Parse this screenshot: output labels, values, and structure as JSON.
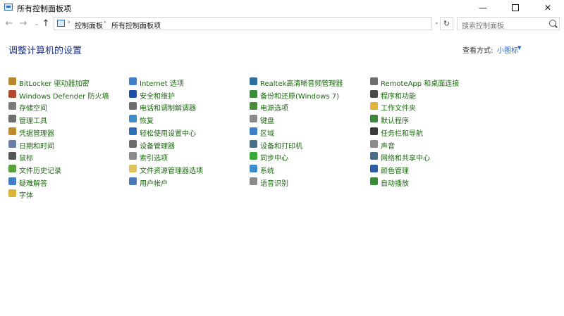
{
  "window": {
    "title": "所有控制面板项"
  },
  "window_controls": {
    "minimize": "—",
    "maximize": "",
    "close": "✕"
  },
  "nav": {
    "back": "←",
    "forward": "→",
    "recent": "⌄",
    "up": "↑",
    "breadcrumb": [
      "控制面板",
      "所有控制面板项"
    ],
    "separator": "›",
    "dropdown": "⌄",
    "refresh": "↻",
    "search_placeholder": "搜索控制面板"
  },
  "header": {
    "title": "调整计算机的设置",
    "view_by_label": "查看方式:",
    "view_by_value": "小图标",
    "view_by_caret": "▼"
  },
  "columns": [
    {
      "items": [
        {
          "label": "BitLocker 驱动器加密",
          "icon": "bitlocker-icon",
          "color": "#b8862e"
        },
        {
          "label": "Windows Defender 防火墙",
          "icon": "firewall-icon",
          "color": "#b04a2e"
        },
        {
          "label": "存储空间",
          "icon": "storage-spaces-icon",
          "color": "#7a7a7a"
        },
        {
          "label": "管理工具",
          "icon": "admin-tools-icon",
          "color": "#6d6d6d"
        },
        {
          "label": "凭据管理器",
          "icon": "credential-manager-icon",
          "color": "#c08a2a"
        },
        {
          "label": "日期和时间",
          "icon": "date-time-icon",
          "color": "#6a7fa8"
        },
        {
          "label": "鼠标",
          "icon": "mouse-icon",
          "color": "#555555"
        },
        {
          "label": "文件历史记录",
          "icon": "file-history-icon",
          "color": "#5ba03a"
        },
        {
          "label": "疑难解答",
          "icon": "troubleshooting-icon",
          "color": "#3f7cc2"
        },
        {
          "label": "字体",
          "icon": "fonts-icon",
          "color": "#d8b43a"
        }
      ]
    },
    {
      "items": [
        {
          "label": "Internet 选项",
          "icon": "internet-options-icon",
          "color": "#3d7fc8"
        },
        {
          "label": "安全和维护",
          "icon": "security-maintenance-icon",
          "color": "#1e4fa8"
        },
        {
          "label": "电话和调制解调器",
          "icon": "phone-modem-icon",
          "color": "#6d6d6d"
        },
        {
          "label": "恢复",
          "icon": "recovery-icon",
          "color": "#3d8ec8"
        },
        {
          "label": "轻松使用设置中心",
          "icon": "ease-of-access-icon",
          "color": "#2a6fb8"
        },
        {
          "label": "设备管理器",
          "icon": "device-manager-icon",
          "color": "#6d6d6d"
        },
        {
          "label": "索引选项",
          "icon": "indexing-options-icon",
          "color": "#8a8a8a"
        },
        {
          "label": "文件资源管理器选项",
          "icon": "file-explorer-options-icon",
          "color": "#e2c15a"
        },
        {
          "label": "用户帐户",
          "icon": "user-accounts-icon",
          "color": "#4a7ab8"
        }
      ]
    },
    {
      "items": [
        {
          "label": "Realtek高清晰音频管理器",
          "icon": "realtek-audio-icon",
          "color": "#2e6e9e"
        },
        {
          "label": "备份和还原(Windows 7)",
          "icon": "backup-restore-icon",
          "color": "#3a8a3a"
        },
        {
          "label": "电源选项",
          "icon": "power-options-icon",
          "color": "#4a8a3a"
        },
        {
          "label": "键盘",
          "icon": "keyboard-icon",
          "color": "#8a8a8a"
        },
        {
          "label": "区域",
          "icon": "region-icon",
          "color": "#3d7fc8"
        },
        {
          "label": "设备和打印机",
          "icon": "devices-printers-icon",
          "color": "#4a6e8a"
        },
        {
          "label": "同步中心",
          "icon": "sync-center-icon",
          "color": "#3aa83a"
        },
        {
          "label": "系统",
          "icon": "system-icon",
          "color": "#3d8ec8"
        },
        {
          "label": "语音识别",
          "icon": "speech-recognition-icon",
          "color": "#8a8a8a"
        }
      ]
    },
    {
      "items": [
        {
          "label": "RemoteApp 和桌面连接",
          "icon": "remoteapp-icon",
          "color": "#6d6d6d"
        },
        {
          "label": "程序和功能",
          "icon": "programs-features-icon",
          "color": "#4a4a4a"
        },
        {
          "label": "工作文件夹",
          "icon": "work-folders-icon",
          "color": "#e2b43a"
        },
        {
          "label": "默认程序",
          "icon": "default-programs-icon",
          "color": "#3a8a3a"
        },
        {
          "label": "任务栏和导航",
          "icon": "taskbar-navigation-icon",
          "color": "#3a3a3a"
        },
        {
          "label": "声音",
          "icon": "sound-icon",
          "color": "#8a8a8a"
        },
        {
          "label": "网络和共享中心",
          "icon": "network-sharing-icon",
          "color": "#4a6e8a"
        },
        {
          "label": "颜色管理",
          "icon": "color-management-icon",
          "color": "#2a5ea8"
        },
        {
          "label": "自动播放",
          "icon": "autoplay-icon",
          "color": "#3a8a3a"
        }
      ]
    }
  ]
}
